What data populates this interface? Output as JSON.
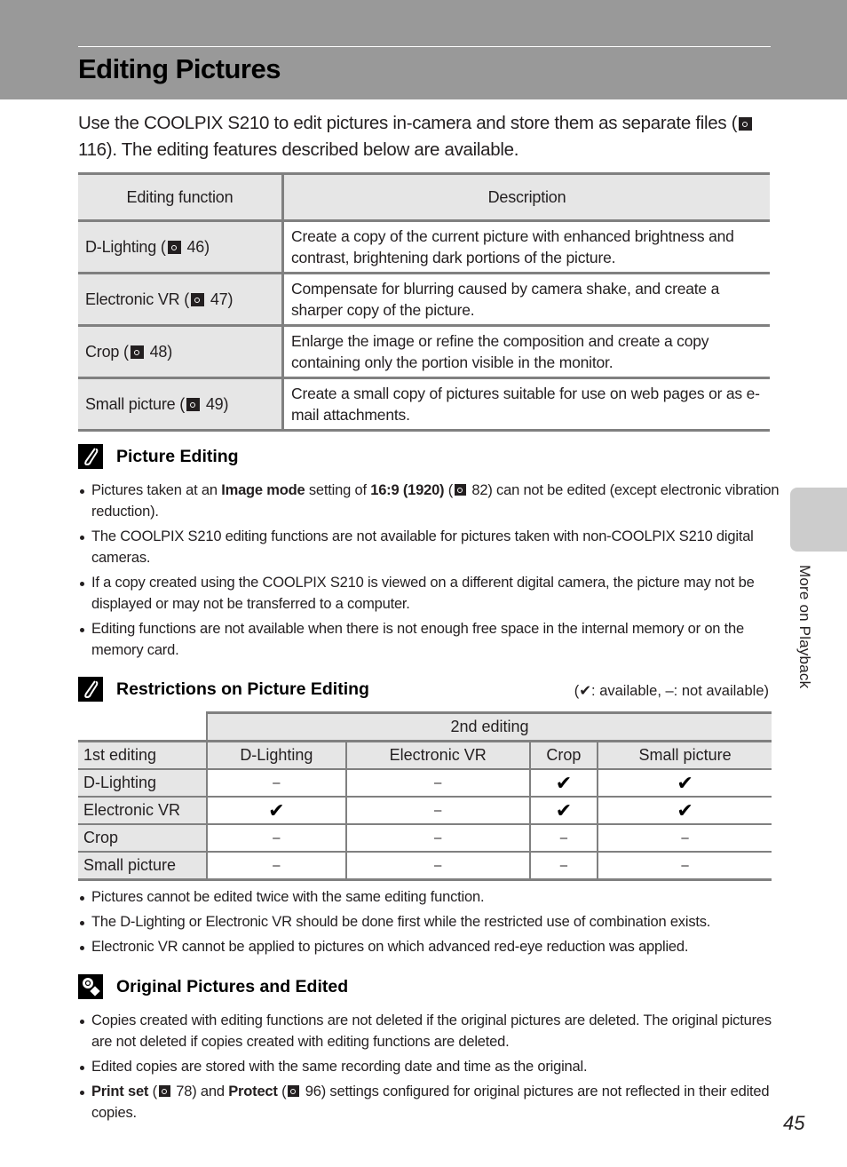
{
  "page": {
    "title": "Editing Pictures",
    "page_number": "45",
    "side_tab_label": "More on Playback"
  },
  "intro": {
    "before_ref": "Use the COOLPIX S210 to edit pictures in-camera and store them as separate files (",
    "ref_page": "116",
    "after_ref": "). The editing features described below are available."
  },
  "functions_table": {
    "headers": [
      "Editing function",
      "Description"
    ],
    "rows": [
      {
        "name": "D-Lighting (",
        "ref": "46",
        "close": ")",
        "description": "Create a copy of the current picture with enhanced brightness and contrast, brightening dark portions of the picture."
      },
      {
        "name": "Electronic VR (",
        "ref": "47",
        "close": ")",
        "description": "Compensate for blurring caused by camera shake, and create a sharper copy of the picture."
      },
      {
        "name": "Crop (",
        "ref": "48",
        "close": ")",
        "description": "Enlarge the image or refine the composition and create a copy containing only the portion visible in the monitor."
      },
      {
        "name": "Small picture (",
        "ref": "49",
        "close": ")",
        "description": "Create a small copy of pictures suitable for use on web pages or as e-mail attachments."
      }
    ]
  },
  "picture_editing": {
    "icon": "paperclip-icon",
    "heading": "Picture Editing",
    "bullet1": {
      "a": "Pictures taken at an ",
      "b_bold": "Image mode",
      "c": " setting of ",
      "d_bold": "16:9 (1920)",
      "e": " (",
      "ref": "82",
      "f": ") can not be edited (except electronic vibration reduction)."
    },
    "bullets": [
      "The COOLPIX S210 editing functions are not available for pictures taken with non-COOLPIX S210 digital cameras.",
      "If a copy created using the COOLPIX S210 is viewed on a different digital camera, the picture may not be displayed or may not be transferred to a computer.",
      "Editing functions are not available when there is not enough free space in the internal memory or on the memory card."
    ]
  },
  "restrictions": {
    "icon": "paperclip-icon",
    "heading": "Restrictions on Picture Editing",
    "legend": "(✔: available, –: not available)",
    "span_header": "2nd editing",
    "row_header_label": "1st editing",
    "columns": [
      "D-Lighting",
      "Electronic VR",
      "Crop",
      "Small picture"
    ],
    "rows": [
      {
        "label": "D-Lighting",
        "cells": [
          "–",
          "–",
          "✔",
          "✔"
        ]
      },
      {
        "label": "Electronic VR",
        "cells": [
          "✔",
          "–",
          "✔",
          "✔"
        ]
      },
      {
        "label": "Crop",
        "cells": [
          "–",
          "–",
          "–",
          "–"
        ]
      },
      {
        "label": "Small picture",
        "cells": [
          "–",
          "–",
          "–",
          "–"
        ]
      }
    ],
    "bullets": [
      "Pictures cannot be edited twice with the same editing function.",
      "The D-Lighting or Electronic VR should be done first while the restricted use of combination exists.",
      "Electronic VR cannot be applied to pictures on which advanced red-eye reduction was applied."
    ]
  },
  "original_pictures": {
    "icon": "info-bulb-icon",
    "heading": "Original Pictures and Edited",
    "bullets": [
      "Copies created with editing functions are not deleted if the original pictures are deleted. The original pictures are not deleted if copies created with editing functions are deleted.",
      "Edited copies are stored with the same recording date and time as the original."
    ],
    "bullet3": {
      "a_bold": "Print set",
      "b": " (",
      "ref1": "78",
      "c": ") and ",
      "d_bold": "Protect",
      "e": " (",
      "ref2": "96",
      "f": ") settings configured for original pictures are not reflected in their edited copies."
    }
  }
}
